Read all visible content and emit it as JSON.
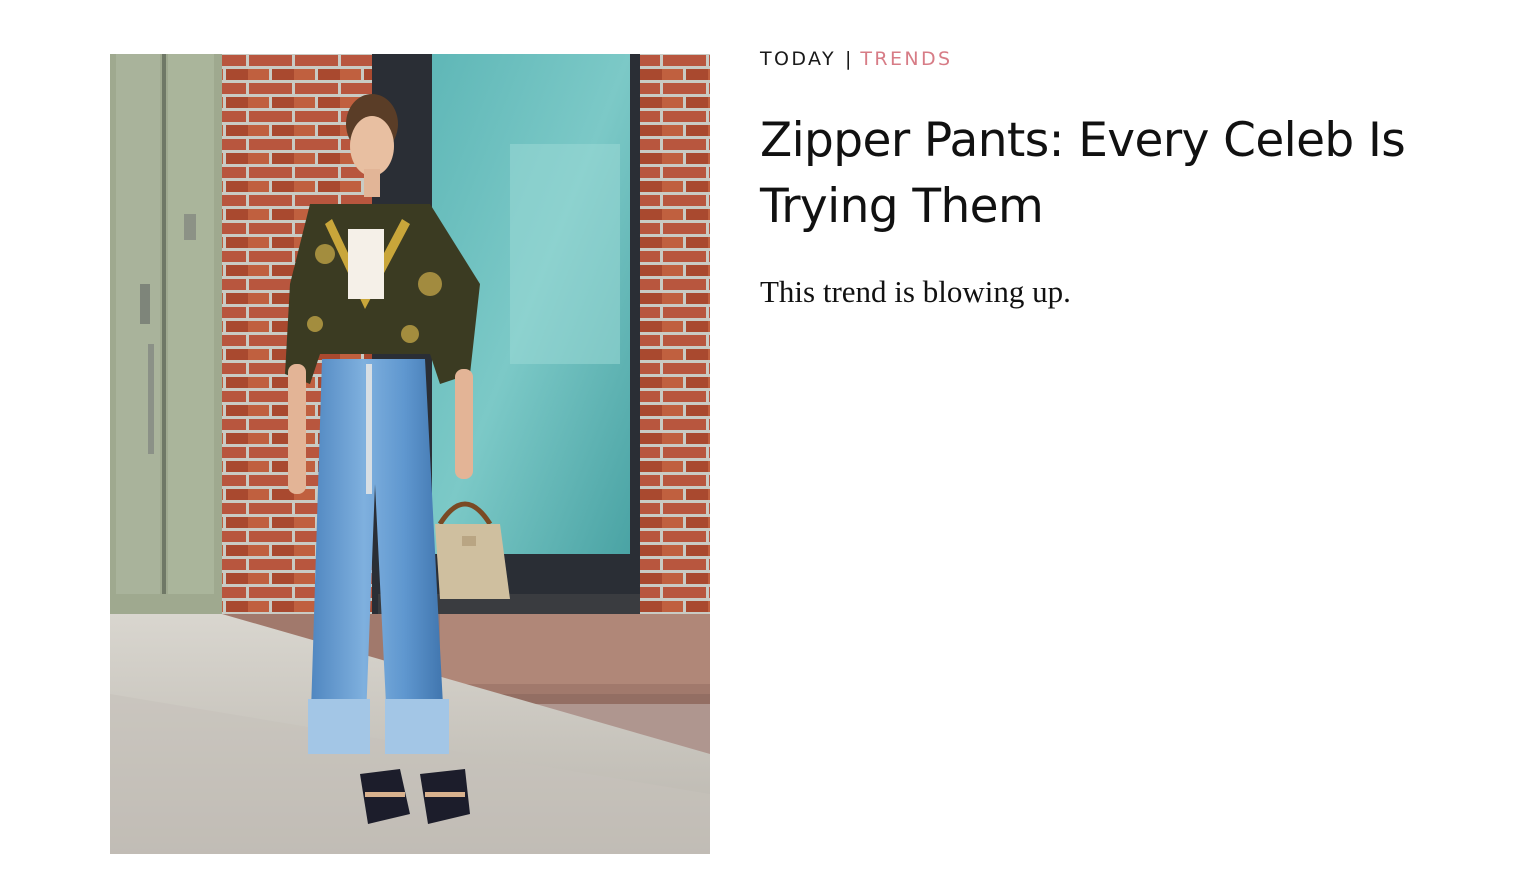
{
  "article": {
    "date_label": "TODAY",
    "separator": "|",
    "category": "TRENDS",
    "headline": "Zipper Pants: Every Celeb Is Trying Them",
    "dek": "This trend is blowing up.",
    "photo_icon": "street-style-photo"
  },
  "colors": {
    "category_accent": "#d77c86",
    "text": "#111111",
    "background": "#ffffff"
  }
}
